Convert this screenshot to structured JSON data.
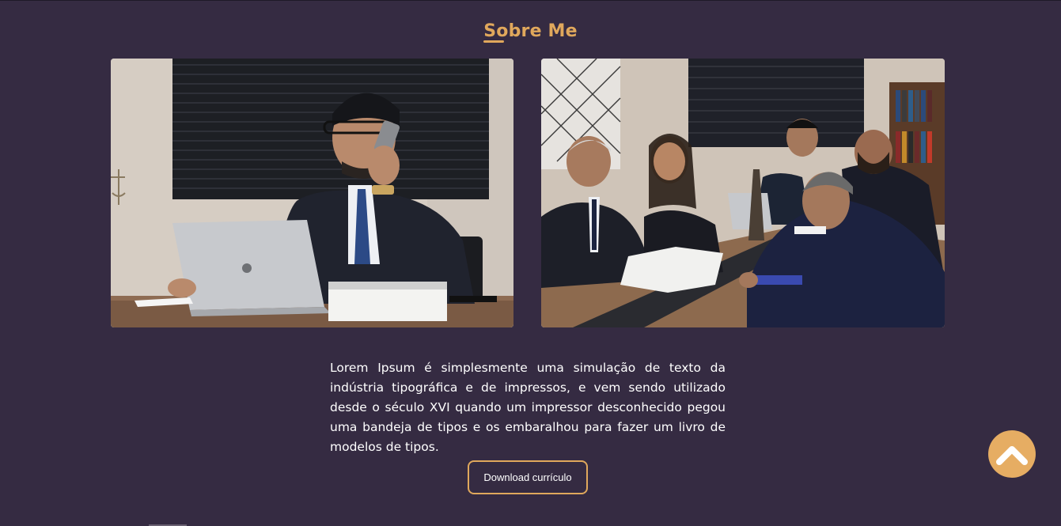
{
  "section": {
    "title": "Sobre Me"
  },
  "about": {
    "paragraph": "Lorem Ipsum é simplesmente uma simulação de texto da indústria tipográfica e de impressos, e vem sendo utilizado desde o século XVI quando um impressor desconhecido pegou uma bandeja de tipos e os embaralhou para fazer um livro de modelos de tipos."
  },
  "actions": {
    "download_label": "Download currículo",
    "scroll_top_icon": "chevron-up-icon"
  },
  "colors": {
    "background": "#352b42",
    "accent": "#e0a85c",
    "text": "#ffffff"
  }
}
